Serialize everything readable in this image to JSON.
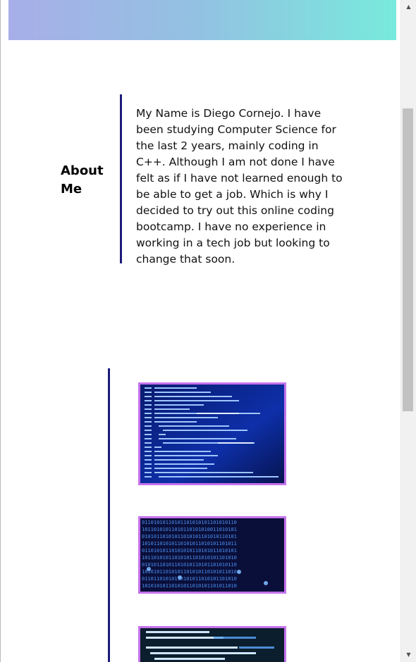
{
  "about": {
    "heading": "About Me",
    "text": "My Name is Diego Cornejo. I have been studying Computer Science for the last 2 years, mainly coding in C++. Although I am not done I have felt as if I have not learned enough to be able to get a job. Which is why I decided to try out this online coding bootcamp. I have no experience in working in a tech job but looking to change that soon."
  },
  "portfolio": {
    "items": [
      {
        "image": "code-editor-screenshot"
      },
      {
        "image": "binary-code-background"
      },
      {
        "image": "javascript-code-screenshot"
      }
    ]
  },
  "scrollbar": {
    "up_icon": "▲",
    "down_icon": "▼"
  },
  "colors": {
    "header_gradient_start": "#a8aee8",
    "header_gradient_end": "#78eadc",
    "divider": "#1b1b7a",
    "thumbnail_border": "#c572ec"
  }
}
